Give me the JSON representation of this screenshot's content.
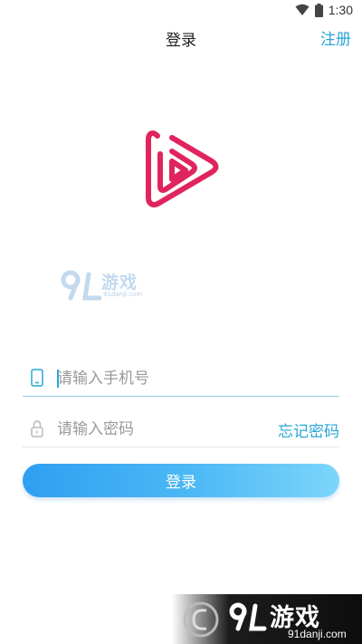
{
  "status_bar": {
    "time": "1:30",
    "icons": [
      "wifi-icon",
      "battery-icon"
    ]
  },
  "header": {
    "title": "登录",
    "register_label": "注册"
  },
  "watermark_mid": {
    "text": "游戏",
    "url": "91danji.com"
  },
  "form": {
    "phone": {
      "placeholder": "请输入手机号",
      "value": "",
      "icon": "phone-icon"
    },
    "password": {
      "placeholder": "请输入密码",
      "value": "",
      "icon": "lock-icon"
    },
    "forgot_label": "忘记密码",
    "login_label": "登录"
  },
  "watermark_banner": {
    "text": "游戏",
    "url": "91danji.com"
  },
  "colors": {
    "accent": "#2aa6d6",
    "logo": "#e0245e",
    "button_start": "#2f9ff2",
    "button_end": "#7dd6fb"
  }
}
